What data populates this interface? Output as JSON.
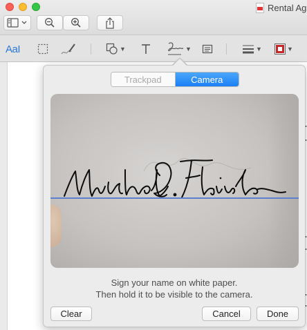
{
  "window": {
    "doc_title": "Rental Ag",
    "icons": [
      "sidebar-icon",
      "zoom-out-icon",
      "zoom-in-icon",
      "share-icon"
    ]
  },
  "markup_toolbar": {
    "text_style_label": "AaI",
    "tools": [
      "text-style-icon",
      "rect-selection-icon",
      "sketch-icon",
      "shapes-icon",
      "text-icon",
      "sign-icon",
      "note-icon",
      "line-style-icon",
      "border-color-icon"
    ],
    "border_color": "#c62828"
  },
  "signature_popover": {
    "tabs": [
      {
        "label": "Trackpad",
        "selected": false
      },
      {
        "label": "Camera",
        "selected": true
      }
    ],
    "signature_text": "Michael D. Fleischner",
    "instructions_line1": "Sign your name on white paper.",
    "instructions_line2": "Then hold it to be visible to the camera.",
    "clear_label": "Clear",
    "cancel_label": "Cancel",
    "done_label": "Done",
    "accent_color": "#1b7ff5"
  }
}
